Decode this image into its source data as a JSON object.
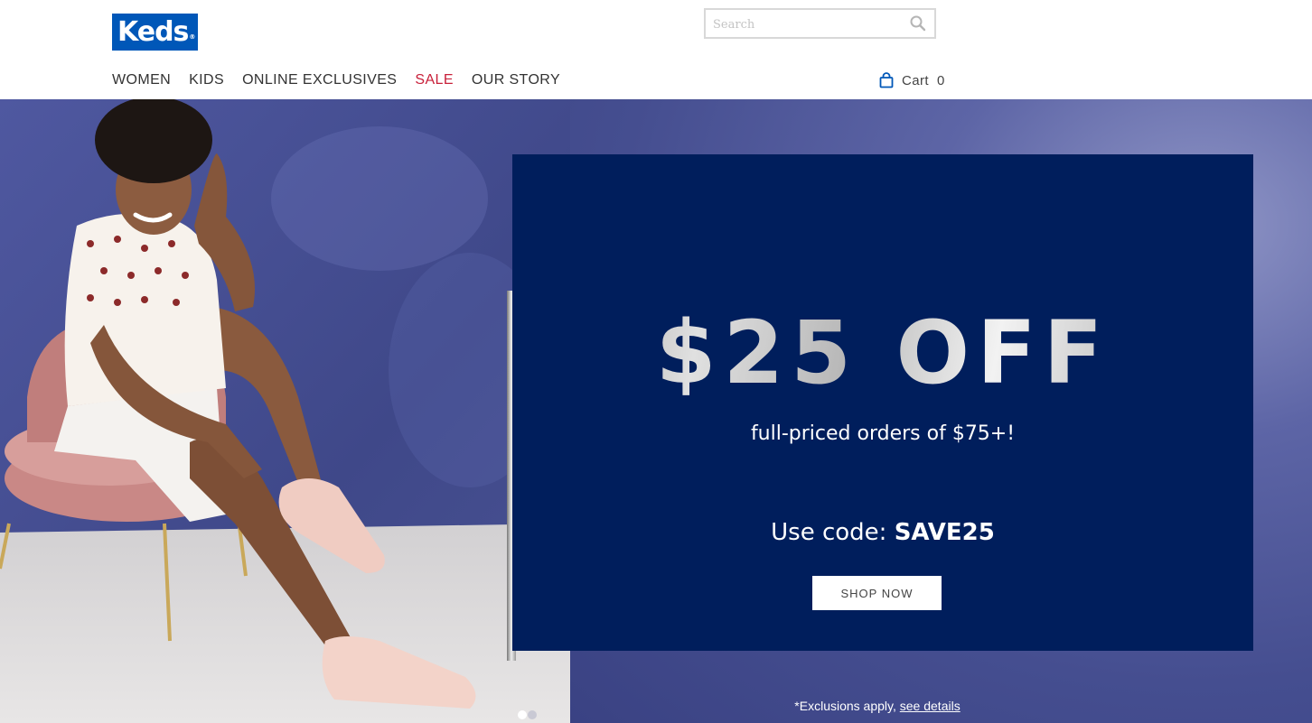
{
  "brand": {
    "logo_text": "Keds",
    "logo_mark": "®",
    "color": "#0057b8"
  },
  "search": {
    "placeholder": "Search",
    "value": ""
  },
  "nav": {
    "items": [
      {
        "label": "WOMEN"
      },
      {
        "label": "KIDS"
      },
      {
        "label": "ONLINE EXCLUSIVES"
      },
      {
        "label": "SALE",
        "color": "#c8203a"
      },
      {
        "label": "OUR STORY"
      }
    ]
  },
  "cart": {
    "label": "Cart",
    "count": "0",
    "icon": "shopping-bag-icon"
  },
  "hero": {
    "headline": "$25 OFF",
    "subline": "full-priced orders of $75+!",
    "code_prefix": "Use code: ",
    "code": "SAVE25",
    "cta": "SHOP NOW",
    "exclusions_text": "*Exclusions apply, ",
    "details_link": "see details",
    "panel_color": "#001e5c",
    "slides": 2,
    "active_slide": 1
  }
}
